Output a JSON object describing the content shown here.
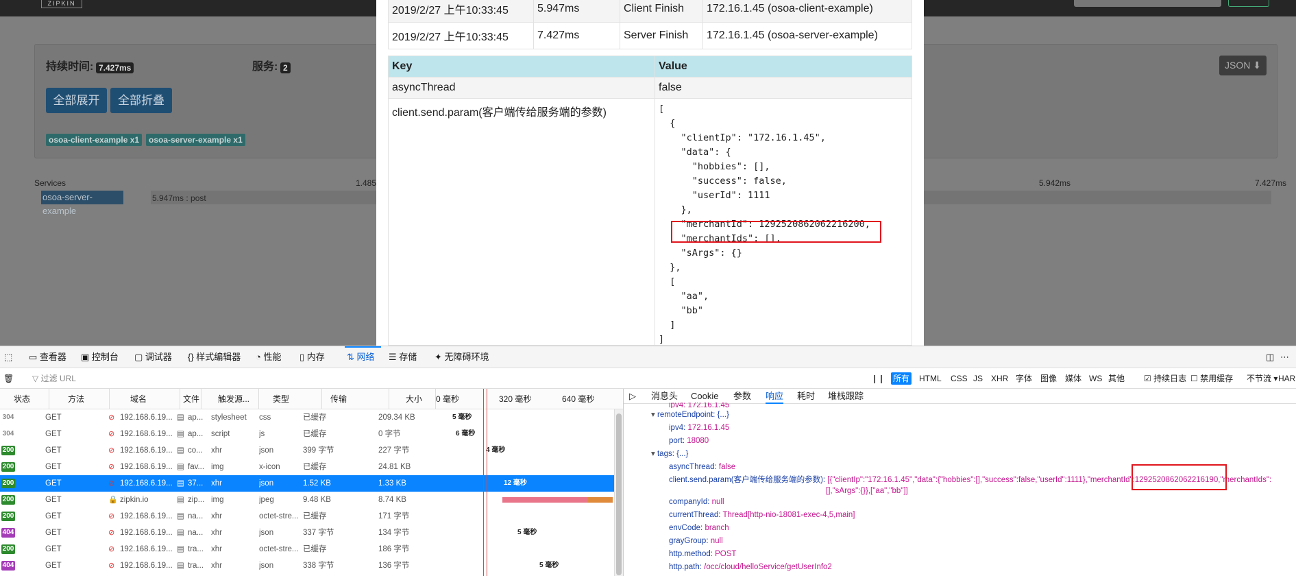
{
  "zipkin": {
    "logo": "ZIPKIN",
    "duration_label": "持续时间:",
    "duration_value": "7.427ms",
    "services_label": "服务:",
    "services_count": "2",
    "expand_all": "全部展开",
    "collapse_all": "全部折叠",
    "tags": [
      "osoa-client-example x1",
      "osoa-server-example x1"
    ],
    "json_button": "JSON",
    "timeline_services": "Services",
    "timeline_ticks": [
      "1.485ms",
      "5.942ms",
      "7.427ms"
    ],
    "service_name": "osoa-server-example",
    "span_label": "5.947ms : post"
  },
  "annotations": [
    {
      "date": "2019/2/27 上午10:33:45",
      "rel": "5.947ms",
      "annotation": "Client Finish",
      "address": "172.16.1.45 (osoa-client-example)"
    },
    {
      "date": "2019/2/27 上午10:33:45",
      "rel": "7.427ms",
      "annotation": "Server Finish",
      "address": "172.16.1.45 (osoa-server-example)"
    }
  ],
  "kv": {
    "header_key": "Key",
    "header_value": "Value",
    "row1_key": "asyncThread",
    "row1_value": "false",
    "row2_key": "client.send.param(客户端传给服务端的参数)",
    "row2_value": "[\n  {\n    \"clientIp\": \"172.16.1.45\",\n    \"data\": {\n      \"hobbies\": [],\n      \"success\": false,\n      \"userId\": 1111\n    },\n    \"merchantId\": 1292520862062216200,\n    \"merchantIds\": [],\n    \"sArgs\": {}\n  },\n  [\n    \"aa\",\n    \"bb\"\n  ]\n]"
  },
  "devtools": {
    "tabs": [
      "查看器",
      "控制台",
      "调试器",
      "样式编辑器",
      "性能",
      "内存",
      "网络",
      "存储",
      "无障碍环境"
    ],
    "active_tab": "网络",
    "filter_placeholder": "过滤 URL",
    "type_filters": [
      "所有",
      "HTML",
      "CSS",
      "JS",
      "XHR",
      "字体",
      "图像",
      "媒体",
      "WS",
      "其他"
    ],
    "persist_logs": "持续日志",
    "disable_cache": "禁用缓存",
    "throttling": "不节流",
    "har": "HAR",
    "columns": [
      "状态",
      "方法",
      "域名",
      "文件",
      "触发源...",
      "类型",
      "传输",
      "大小",
      "0 毫秒",
      "320 毫秒",
      "640 毫秒"
    ],
    "requests": [
      {
        "status": "304",
        "method": "GET",
        "domain": "192.168.6.19...",
        "file": "ap...",
        "cause": "stylesheet",
        "type": "css",
        "transferred": "已缓存",
        "size": "209.34 KB",
        "timing": "5 毫秒"
      },
      {
        "status": "304",
        "method": "GET",
        "domain": "192.168.6.19...",
        "file": "ap...",
        "cause": "script",
        "type": "js",
        "transferred": "已缓存",
        "size": "0 字节",
        "timing": "6 毫秒"
      },
      {
        "status": "200",
        "method": "GET",
        "domain": "192.168.6.19...",
        "file": "co...",
        "cause": "xhr",
        "type": "json",
        "transferred": "399 字节",
        "size": "227 字节",
        "timing": "4 毫秒"
      },
      {
        "status": "200",
        "method": "GET",
        "domain": "192.168.6.19...",
        "file": "fav...",
        "cause": "img",
        "type": "x-icon",
        "transferred": "已缓存",
        "size": "24.81 KB",
        "timing": ""
      },
      {
        "status": "200",
        "method": "GET",
        "domain": "192.168.6.19...",
        "file": "37...",
        "cause": "xhr",
        "type": "json",
        "transferred": "1.52 KB",
        "size": "1.33 KB",
        "timing": "12 毫秒"
      },
      {
        "status": "200",
        "method": "GET",
        "domain": "zipkin.io",
        "file": "zip...",
        "cause": "img",
        "type": "jpeg",
        "transferred": "9.48 KB",
        "size": "8.74 KB",
        "timing": ""
      },
      {
        "status": "200",
        "method": "GET",
        "domain": "192.168.6.19...",
        "file": "na...",
        "cause": "xhr",
        "type": "octet-stre...",
        "transferred": "已缓存",
        "size": "171 字节",
        "timing": ""
      },
      {
        "status": "404",
        "method": "GET",
        "domain": "192.168.6.19...",
        "file": "na...",
        "cause": "xhr",
        "type": "json",
        "transferred": "337 字节",
        "size": "134 字节",
        "timing": "5 毫秒"
      },
      {
        "status": "200",
        "method": "GET",
        "domain": "192.168.6.19...",
        "file": "tra...",
        "cause": "xhr",
        "type": "octet-stre...",
        "transferred": "已缓存",
        "size": "186 字节",
        "timing": ""
      },
      {
        "status": "404",
        "method": "GET",
        "domain": "192.168.6.19...",
        "file": "tra...",
        "cause": "xhr",
        "type": "json",
        "transferred": "338 字节",
        "size": "136 字节",
        "timing": "5 毫秒"
      }
    ],
    "detail_tabs": [
      "消息头",
      "Cookie",
      "参数",
      "响应",
      "耗时",
      "堆栈跟踪"
    ],
    "active_detail_tab": "响应",
    "response": {
      "top_cut": "ipv4: 172.16.1.45",
      "remote_endpoint": "remoteEndpoint: {...}",
      "ipv4_key": "ipv4:",
      "ipv4_val": "172.16.1.45",
      "port_key": "port:",
      "port_val": "18080",
      "tags_key": "tags: {...}",
      "lines": [
        {
          "key": "asyncThread:",
          "value": "false"
        },
        {
          "key": "client.send.param(客户端传给服务端的参数):",
          "value": "[{\"clientIp\":\"172.16.1.45\",\"data\":{\"hobbies\":[],\"success\":false,\"userId\":1111},\"merchantId\":1292520862062216190,\"merchantIds\":"
        },
        {
          "key": "",
          "value": "[],\"sArgs\":{}},[\"aa\",\"bb\"]]"
        },
        {
          "key": "companyId:",
          "value": "null"
        },
        {
          "key": "currentThread:",
          "value": "Thread[http-nio-18081-exec-4,5,main]"
        },
        {
          "key": "envCode:",
          "value": "branch"
        },
        {
          "key": "grayGroup:",
          "value": "null"
        },
        {
          "key": "http.method:",
          "value": "POST"
        },
        {
          "key": "http.path:",
          "value": "/occ/cloud/helloService/getUserInfo2"
        }
      ]
    }
  },
  "colors": {
    "accent": "#0a84ff",
    "highlight": "#e0141c",
    "kv_header": "#bee4ec"
  }
}
